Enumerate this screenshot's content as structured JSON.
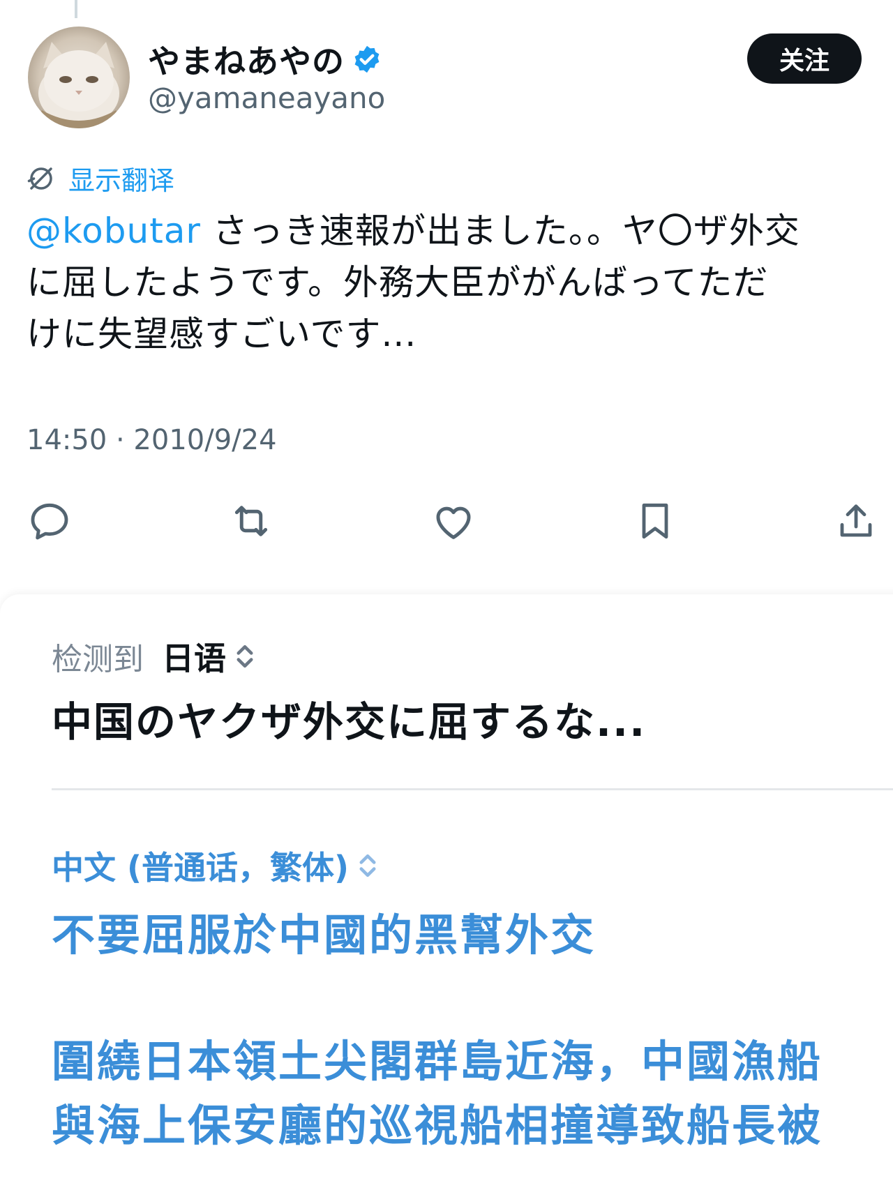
{
  "tweet": {
    "display_name": "やまねあやの",
    "handle": "@yamaneayano",
    "follow_label": "关注",
    "translate_label": "显示翻译",
    "mention": "@kobutar",
    "body_line1": " さっき速報が出ました。。ヤ〇ザ外交",
    "body_line2": "に屈したようです。外務大臣ががんばってただ",
    "body_line3": "けに失望感すごいです...",
    "timestamp": "14:50 · 2010/9/24"
  },
  "actions": {
    "icons": [
      "reply-icon",
      "retweet-icon",
      "like-icon",
      "bookmark-icon",
      "share-icon"
    ]
  },
  "translation": {
    "detected_label": "检测到",
    "detected_lang": "日语",
    "source_text": "中国のヤクザ外交に屈するな...",
    "target_lang": "中文 (普通话，繁体)",
    "target_title": "不要屈服於中國的黑幫外交",
    "target_para_line1": "圍繞日本領土尖閣群島近海，中國漁船",
    "target_para_line2": "與海上保安廳的巡視船相撞導致船長被"
  },
  "colors": {
    "accent": "#1d9bf0",
    "translation_blue": "#3b8ed8",
    "text": "#0f1419",
    "muted": "#536471"
  }
}
